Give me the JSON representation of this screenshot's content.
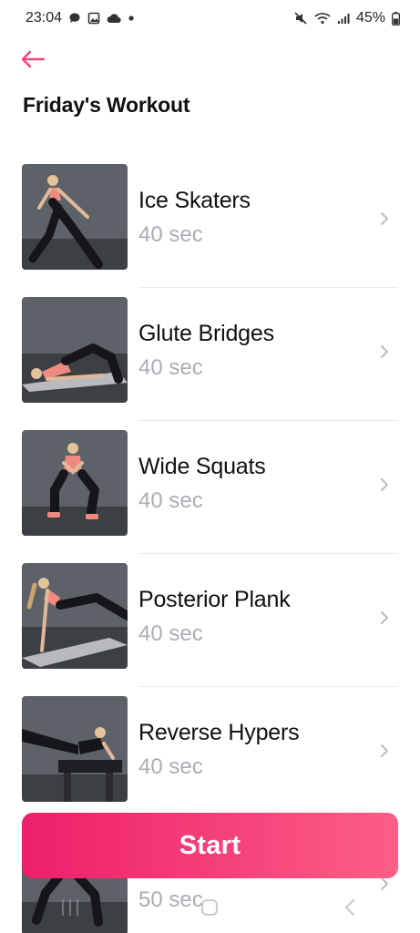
{
  "status_bar": {
    "time": "23:04",
    "battery": "45%",
    "left_icons": [
      "chat-icon",
      "image-icon",
      "cloud-icon",
      "dot-icon"
    ],
    "right_icons": [
      "mute-icon",
      "wifi-icon",
      "signal-icon",
      "battery-icon"
    ]
  },
  "header": {
    "back_icon": "arrow-left-icon",
    "title": "Friday's Workout"
  },
  "exercises": [
    {
      "name": "Ice Skaters",
      "duration": "40 sec",
      "pose": "skater"
    },
    {
      "name": "Glute Bridges",
      "duration": "40 sec",
      "pose": "bridge"
    },
    {
      "name": "Wide Squats",
      "duration": "40 sec",
      "pose": "squat"
    },
    {
      "name": "Posterior Plank",
      "duration": "40 sec",
      "pose": "plank"
    },
    {
      "name": "Reverse Hypers",
      "duration": "40 sec",
      "pose": "hyper"
    },
    {
      "name": "",
      "duration": "50 sec",
      "pose": "lunge"
    }
  ],
  "start_button": {
    "label": "Start"
  },
  "nav_bar": {
    "icons": [
      "recent-apps-icon",
      "home-icon",
      "back-nav-icon"
    ]
  },
  "colors": {
    "accent": "#ee1f6a",
    "accent_end": "#fb5e86",
    "back_arrow": "#f0457f",
    "duration_text": "#a9aeb5",
    "divider": "#e9e9ee"
  }
}
